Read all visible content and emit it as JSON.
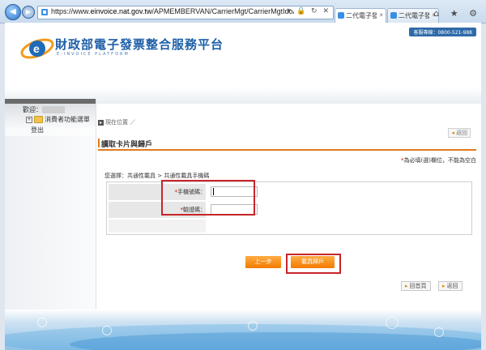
{
  "browser": {
    "url_prefix": "https://www.",
    "url_host": "einvoice.nat.gov.tw",
    "url_path": "/APMEMBERVAN/CarrierMgt/CarrierMgtIdoAggregateCarrier",
    "tabs": [
      {
        "label": "二代電子發..."
      },
      {
        "label": "二代電子發票..."
      }
    ],
    "window_icons": "⌂ ★ ⚙"
  },
  "header": {
    "site_title": "財政部電子發票整合服務平台",
    "site_subtitle": "E-INVOICE PLATFORM",
    "hotline": "客服專線：0800-521-988"
  },
  "sidebar": {
    "welcome": "歡迎：",
    "menu_item": "消費者功能選單",
    "logout": "登出"
  },
  "main": {
    "breadcrumb": "現在位置 ／",
    "back_top": "返回",
    "section_title": "讀取卡片與歸戶",
    "required_note_star": "*",
    "required_note": "為必填(選)欄位，不能為空白",
    "selection": "您選擇：共通性載具 > 共通性載具手機碼",
    "fields": [
      {
        "star": "*",
        "label": "手機號碼：",
        "value": ""
      },
      {
        "star": "*",
        "label": "驗證碼：",
        "value": ""
      }
    ],
    "prev_button": "上一步",
    "bind_button": "載具歸戶",
    "home_button": "回首頁",
    "back_button": "返回"
  }
}
